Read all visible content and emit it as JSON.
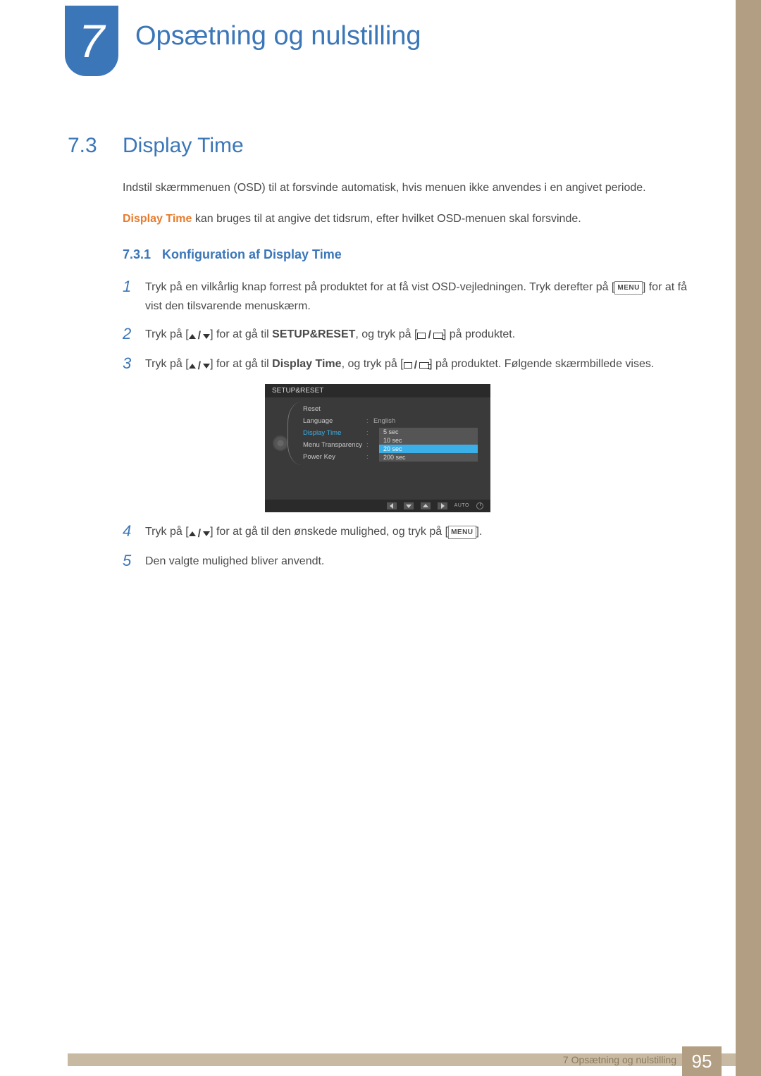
{
  "chapter": {
    "number": "7",
    "title": "Opsætning og nulstilling"
  },
  "section": {
    "number": "7.3",
    "title": "Display Time"
  },
  "intro": {
    "p1": "Indstil skærmmenuen (OSD) til at forsvinde automatisk, hvis menuen ikke anvendes i en angivet periode.",
    "p2_bold": "Display Time",
    "p2_rest": " kan bruges til at angive det tidsrum, efter hvilket OSD-menuen skal forsvinde."
  },
  "subsection": {
    "number": "7.3.1",
    "title": "Konfiguration af Display Time"
  },
  "steps": {
    "s1": {
      "num": "1",
      "a": "Tryk på en vilkårlig knap forrest på produktet for at få vist OSD-vejledningen. Tryk derefter på [",
      "menu": "MENU",
      "b": "] for at få vist den tilsvarende menuskærm."
    },
    "s2": {
      "num": "2",
      "a": "Tryk på [",
      "b": "] for at gå til ",
      "target": "SETUP&RESET",
      "c": ", og tryk på [",
      "d": "] på produktet."
    },
    "s3": {
      "num": "3",
      "a": "Tryk på [",
      "b": "] for at gå til ",
      "target": "Display Time",
      "c": ", og tryk på [",
      "d": "] på produktet. Følgende skærmbillede vises."
    },
    "s4": {
      "num": "4",
      "a": "Tryk på [",
      "b": "] for at gå til den ønskede mulighed, og tryk på [",
      "menu": "MENU",
      "c": "]."
    },
    "s5": {
      "num": "5",
      "text": "Den valgte mulighed bliver anvendt."
    }
  },
  "osd": {
    "title": "SETUP&RESET",
    "items": {
      "reset": "Reset",
      "language": "Language",
      "language_val": "English",
      "display_time": "Display Time",
      "menu_transparency": "Menu Transparency",
      "power_key": "Power Key"
    },
    "options": [
      "5 sec",
      "10 sec",
      "20 sec",
      "200 sec"
    ],
    "selected_option": "20 sec",
    "auto": "AUTO"
  },
  "footer": {
    "text": "7 Opsætning og nulstilling",
    "page": "95"
  }
}
